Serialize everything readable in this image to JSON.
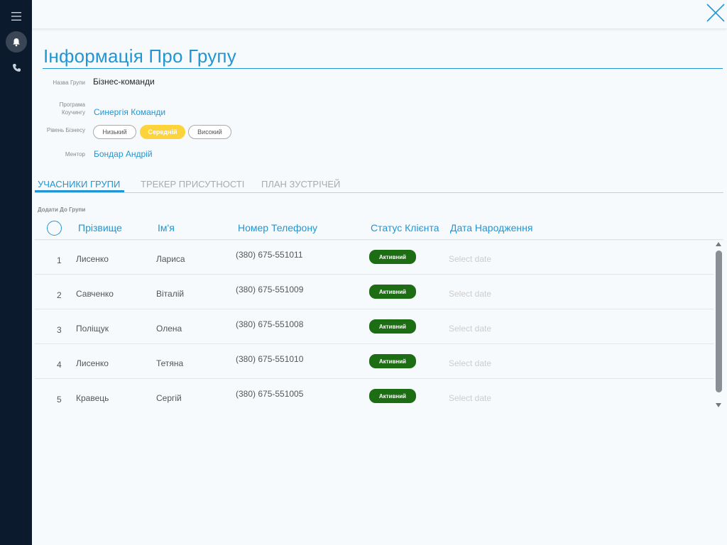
{
  "nav": {
    "icons": [
      "menu-icon",
      "bell-icon",
      "phone-icon"
    ]
  },
  "header": {
    "title": "Інформація Про Групу"
  },
  "fields": {
    "group_name_label": "Назва Групи",
    "group_name_value": "Бізнес-команди",
    "program_label_1": "Програма",
    "program_label_2": "Коучингу",
    "program_value": "Синергія Команди",
    "level_label": "Рівень Бізнесу",
    "levels": [
      "Низький",
      "Середній",
      "Високий"
    ],
    "level_selected": "Середній",
    "mentor_label": "Ментор",
    "mentor_value": "Бондар Андрій"
  },
  "tabs": [
    "УЧАСНИКИ ГРУПИ",
    "ТРЕКЕР ПРИСУТНОСТІ",
    "ПЛАН ЗУСТРІЧЕЙ"
  ],
  "active_tab": "УЧАСНИКИ ГРУПИ",
  "add_link": "Додати До Групи",
  "table": {
    "headers": [
      "Прізвище",
      "Ім'я",
      "Номер Телефону",
      "Статус Клієнта",
      "Дата Народження"
    ],
    "rows": [
      {
        "idx": "1",
        "last": "Лисенко",
        "first": "Лариса",
        "phone": "(380) 675-551011",
        "status": "Активний",
        "date": "Select date"
      },
      {
        "idx": "2",
        "last": "Савченко",
        "first": "Віталій",
        "phone": "(380) 675-551009",
        "status": "Активний",
        "date": "Select date"
      },
      {
        "idx": "3",
        "last": "Поліщук",
        "first": "Олена",
        "phone": "(380) 675-551008",
        "status": "Активний",
        "date": "Select date"
      },
      {
        "idx": "4",
        "last": "Лисенко",
        "first": "Тетяна",
        "phone": "(380) 675-551010",
        "status": "Активний",
        "date": "Select date"
      },
      {
        "idx": "5",
        "last": "Кравець",
        "first": "Сергій",
        "phone": "(380) 675-551005",
        "status": "Активний",
        "date": "Select date"
      }
    ]
  },
  "colors": {
    "accent": "#2196d3",
    "sidebar": "#0c1a2e",
    "selected_level": "#fdd33b",
    "status_active": "#1c6d14"
  }
}
